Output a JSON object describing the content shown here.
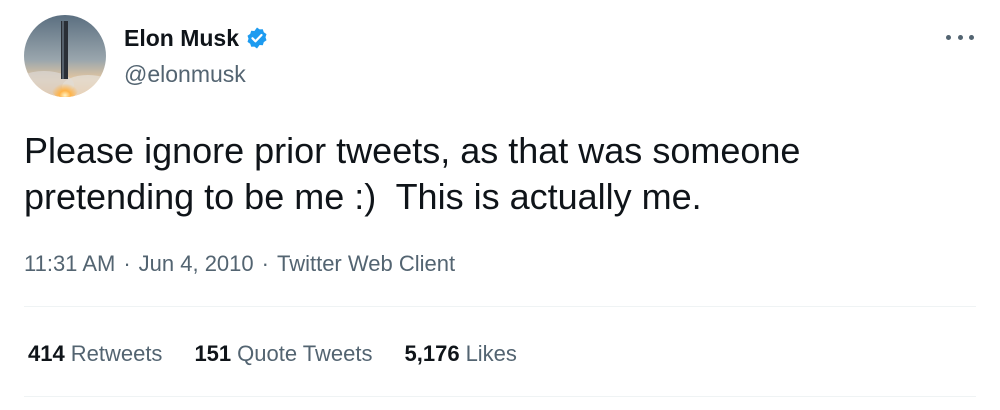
{
  "author": {
    "name": "Elon Musk",
    "handle": "@elonmusk",
    "verified": true,
    "verified_color": "#1d9bf0"
  },
  "tweet": {
    "text": "Please ignore prior tweets, as that was someone\npretending to be me :)  This is actually me.",
    "time": "11:31 AM",
    "date": "Jun 4, 2010",
    "source": "Twitter Web Client",
    "separator": "·"
  },
  "stats": {
    "retweets": {
      "count": "414",
      "label": "Retweets"
    },
    "quote_tweets": {
      "count": "151",
      "label": "Quote Tweets"
    },
    "likes": {
      "count": "5,176",
      "label": "Likes"
    }
  },
  "icons": {
    "more": "more-options-icon",
    "verified": "verified-badge-icon"
  },
  "colors": {
    "text_primary": "#0f1419",
    "text_secondary": "#536471",
    "divider": "#eff3f4"
  }
}
